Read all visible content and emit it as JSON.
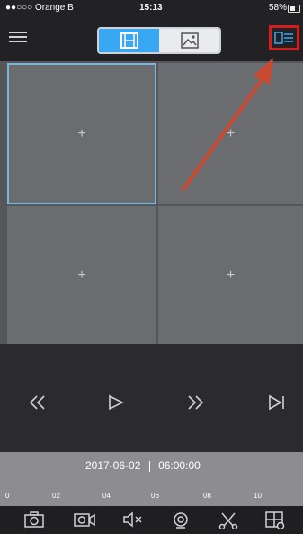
{
  "statusbar": {
    "carrier": "●●○○○ Orange B",
    "time": "15:13",
    "battery": "58%",
    "battery_level": 0.58
  },
  "navbar": {
    "menu_icon": "hamburger-icon",
    "tabs": [
      {
        "icon": "film-icon",
        "active": true
      },
      {
        "icon": "image-icon",
        "active": false
      }
    ],
    "layout_button_icon": "layout-list-icon",
    "highlight_color": "#d11e1e",
    "accent_color": "#3aa7f2"
  },
  "grid": {
    "cells": [
      {
        "symbol": "+",
        "selected": true
      },
      {
        "symbol": "+",
        "selected": false
      },
      {
        "symbol": "+",
        "selected": false
      },
      {
        "symbol": "+",
        "selected": false
      }
    ]
  },
  "annotation": {
    "arrow_color": "#c94a32"
  },
  "controls": [
    "rewind-icon",
    "play-icon",
    "fast-forward-icon",
    "next-frame-icon"
  ],
  "timeline": {
    "date": "2017-06-02",
    "time": "06:00:00",
    "ticks": [
      "0",
      "02",
      "04",
      "06",
      "08",
      "10"
    ]
  },
  "toolbar": [
    "snapshot-icon",
    "record-icon",
    "mute-icon",
    "search-icon",
    "clip-icon",
    "layout-icon"
  ]
}
